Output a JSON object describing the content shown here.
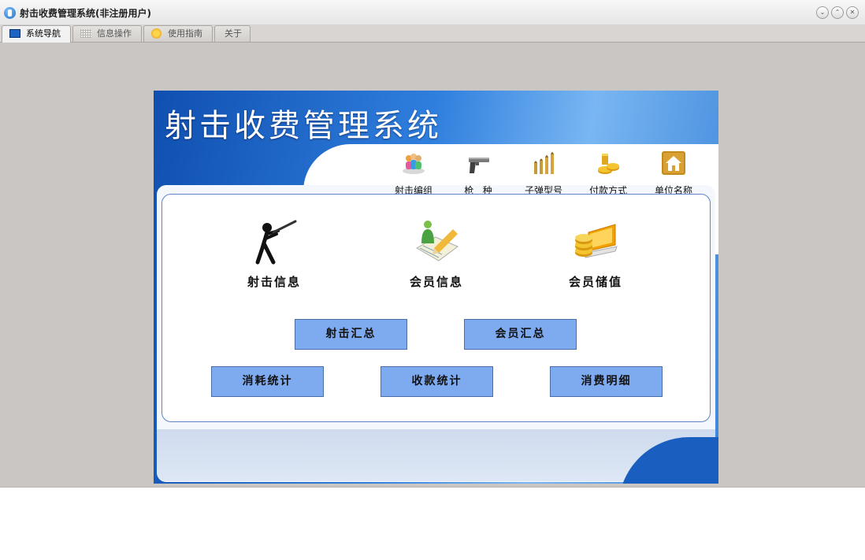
{
  "window": {
    "title": "射击收费管理系统(非注册用户)"
  },
  "tabs": [
    {
      "label": "系统导航",
      "icon": "monitor-icon"
    },
    {
      "label": "信息操作",
      "icon": "grid-icon"
    },
    {
      "label": "使用指南",
      "icon": "guide-icon"
    },
    {
      "label": "关于"
    }
  ],
  "panel": {
    "title": "射击收费管理系统",
    "toolbar": [
      {
        "label": "射击编组",
        "icon": "group-icon"
      },
      {
        "label": "枪   种",
        "icon": "gun-icon"
      },
      {
        "label": "子弹型号",
        "icon": "bullet-icon"
      },
      {
        "label": "付款方式",
        "icon": "coins-icon"
      },
      {
        "label": "单位名称",
        "icon": "home-icon"
      }
    ],
    "features": [
      {
        "label": "射击信息",
        "icon": "shooter-icon"
      },
      {
        "label": "会员信息",
        "icon": "member-edit-icon"
      },
      {
        "label": "会员储值",
        "icon": "deposit-icon"
      }
    ],
    "buttons": {
      "shooting_summary": "射击汇总",
      "member_summary": "会员汇总",
      "consumption_stats": "消耗统计",
      "payment_stats": "收款统计",
      "expense_details": "消费明细"
    }
  }
}
